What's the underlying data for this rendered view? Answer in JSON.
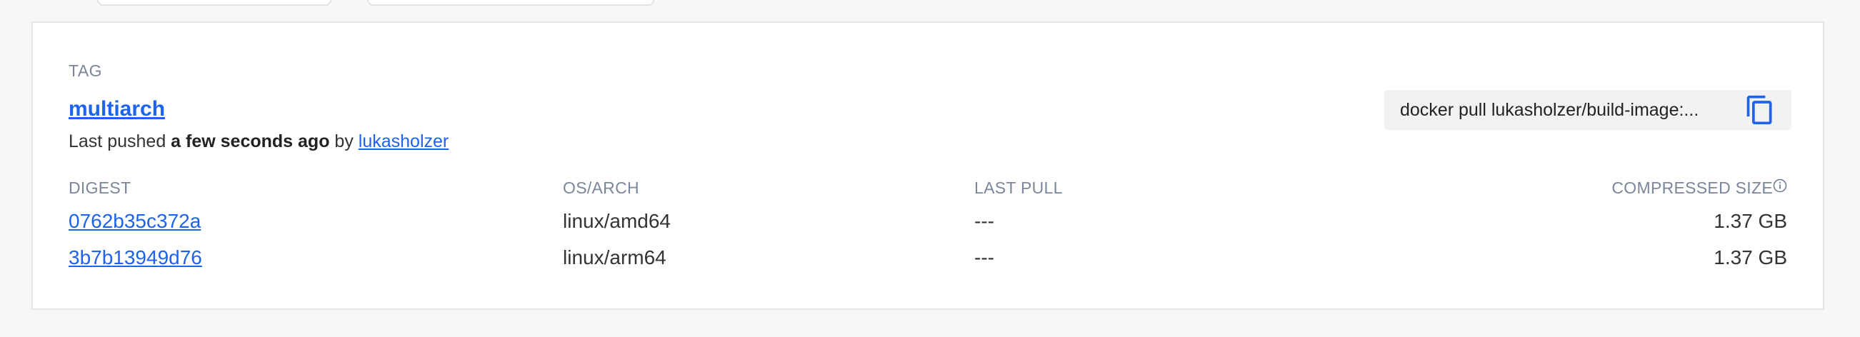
{
  "tag": {
    "label": "TAG",
    "name": "multiarch",
    "pushed_prefix": "Last pushed",
    "pushed_time": "a few seconds ago",
    "pushed_by_word": "by",
    "pushed_by_user": "lukasholzer"
  },
  "pull": {
    "command": "docker pull lukasholzer/build-image:...",
    "copy_icon": "copy-icon"
  },
  "table": {
    "headers": {
      "digest": "DIGEST",
      "os_arch": "OS/ARCH",
      "last_pull": "LAST PULL",
      "compressed_size": "COMPRESSED SIZE"
    },
    "rows": [
      {
        "digest": "0762b35c372a",
        "os_arch": "linux/amd64",
        "last_pull": "---",
        "size": "1.37 GB"
      },
      {
        "digest": "3b7b13949d76",
        "os_arch": "linux/arm64",
        "last_pull": "---",
        "size": "1.37 GB"
      }
    ]
  },
  "colors": {
    "accent": "#1d63ed",
    "muted": "#7a869a",
    "background": "#f7f7f7"
  }
}
